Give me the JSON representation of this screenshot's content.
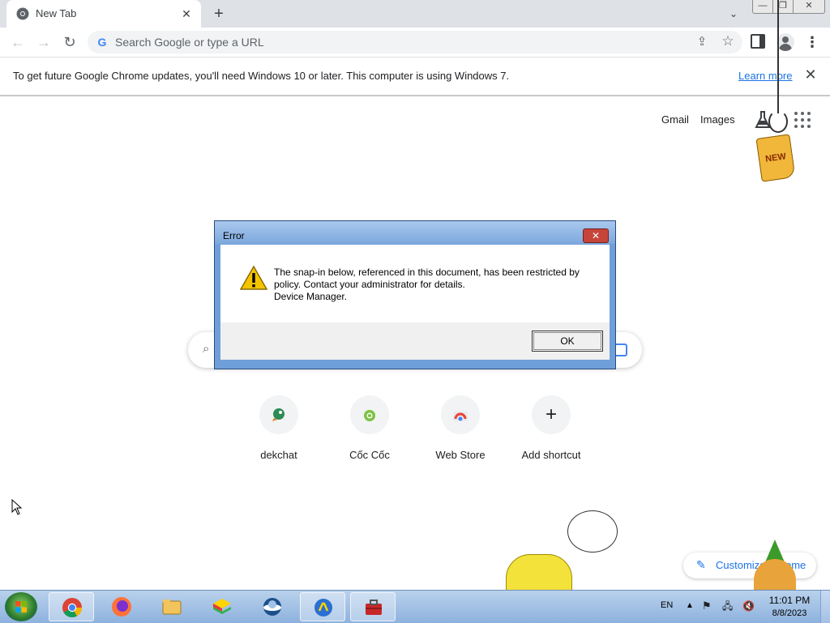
{
  "browser": {
    "tab": {
      "title": "New Tab",
      "icon": "chrome-icon",
      "close": "✕"
    },
    "new_tab": "+",
    "tab_search": "⌄",
    "window_controls": {
      "minimize": "—",
      "maximize": "❐",
      "close": "✕"
    },
    "omnibox": {
      "placeholder": "Search Google or type a URL",
      "value": ""
    },
    "menu": "⋮"
  },
  "infobar": {
    "message": "To get future Google Chrome updates, you'll need Windows 10 or later. This computer is using Windows 7.",
    "link": "Learn more",
    "close": "✕"
  },
  "ntp": {
    "header_links": {
      "gmail": "Gmail",
      "images": "Images"
    },
    "gadget_tag": "NEW",
    "shortcuts": [
      {
        "label": "dekchat",
        "icon": "dekchat-icon"
      },
      {
        "label": "Cốc Cốc",
        "icon": "coccoc-icon"
      },
      {
        "label": "Web Store",
        "icon": "webstore-icon"
      },
      {
        "label": "Add shortcut",
        "icon": "plus-icon",
        "symbol": "+"
      }
    ],
    "customize": "Customize Chrome"
  },
  "dialog": {
    "title": "Error",
    "close": "✕",
    "message_lines": [
      "The snap-in below, referenced in this document, has been restricted by",
      "policy. Contact your administrator for details.",
      "Device Manager."
    ],
    "ok": "OK",
    "icon": "warning-icon"
  },
  "taskbar": {
    "apps": [
      "chrome-icon",
      "firefox-icon",
      "explorer-folder-icon",
      "bluestacks-icon",
      "app-icon",
      "app-icon",
      "toolbox-icon"
    ],
    "language": "EN",
    "tray_up": "▲",
    "clock": {
      "time": "11:01 PM",
      "date": "8/8/2023"
    }
  }
}
